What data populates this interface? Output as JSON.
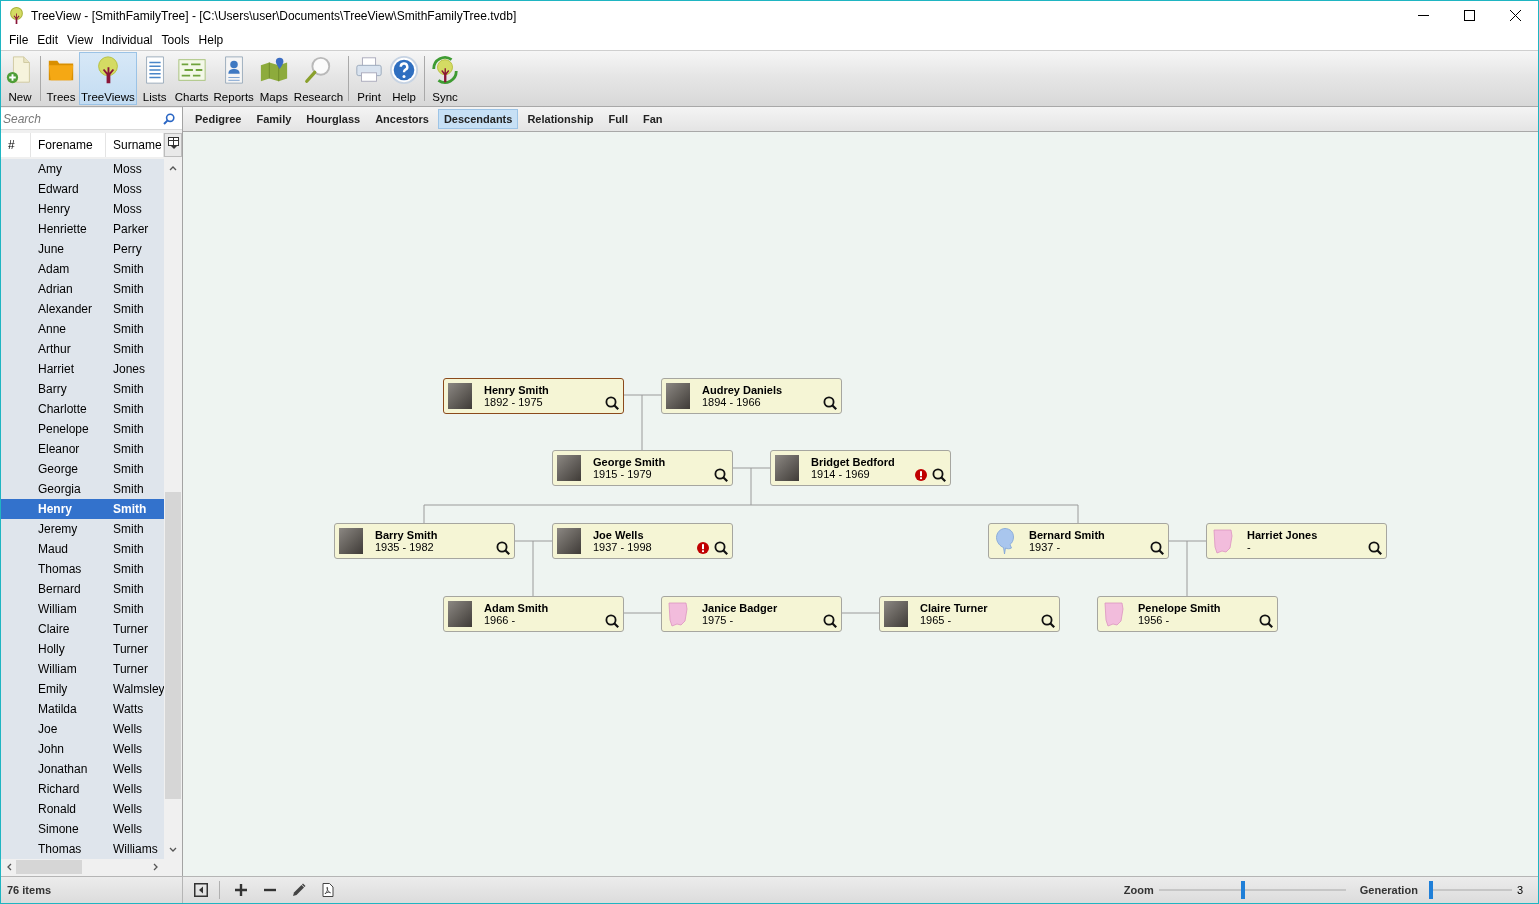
{
  "window": {
    "title": "TreeView - [SmithFamilyTree] - [C:\\Users\\user\\Documents\\TreeView\\SmithFamilyTree.tvdb]"
  },
  "menu": [
    "File",
    "Edit",
    "View",
    "Individual",
    "Tools",
    "Help"
  ],
  "toolbar": [
    {
      "buttons": [
        {
          "label": "New",
          "selected": false
        }
      ]
    },
    {
      "buttons": [
        {
          "label": "Trees",
          "selected": false
        },
        {
          "label": "TreeViews",
          "selected": true
        },
        {
          "label": "Lists",
          "selected": false
        },
        {
          "label": "Charts",
          "selected": false
        },
        {
          "label": "Reports",
          "selected": false
        },
        {
          "label": "Maps",
          "selected": false
        },
        {
          "label": "Research",
          "selected": false
        }
      ]
    },
    {
      "buttons": [
        {
          "label": "Print",
          "selected": false
        },
        {
          "label": "Help",
          "selected": false
        }
      ]
    },
    {
      "buttons": [
        {
          "label": "Sync",
          "selected": false
        }
      ]
    }
  ],
  "sidebar": {
    "search": {
      "placeholder": "Search"
    },
    "columns": [
      "#",
      "Forename",
      "Surname"
    ],
    "rows": [
      {
        "forename": "Amy",
        "surname": "Moss",
        "selected": false
      },
      {
        "forename": "Edward",
        "surname": "Moss",
        "selected": false
      },
      {
        "forename": "Henry",
        "surname": "Moss",
        "selected": false
      },
      {
        "forename": "Henriette",
        "surname": "Parker",
        "selected": false
      },
      {
        "forename": "June",
        "surname": "Perry",
        "selected": false
      },
      {
        "forename": "Adam",
        "surname": "Smith",
        "selected": false
      },
      {
        "forename": "Adrian",
        "surname": "Smith",
        "selected": false
      },
      {
        "forename": "Alexander",
        "surname": "Smith",
        "selected": false
      },
      {
        "forename": "Anne",
        "surname": "Smith",
        "selected": false
      },
      {
        "forename": "Arthur",
        "surname": "Smith",
        "selected": false
      },
      {
        "forename": "Harriet",
        "surname": "Jones",
        "selected": false
      },
      {
        "forename": "Barry",
        "surname": "Smith",
        "selected": false
      },
      {
        "forename": "Charlotte",
        "surname": "Smith",
        "selected": false
      },
      {
        "forename": "Penelope",
        "surname": "Smith",
        "selected": false
      },
      {
        "forename": "Eleanor",
        "surname": "Smith",
        "selected": false
      },
      {
        "forename": "George",
        "surname": "Smith",
        "selected": false
      },
      {
        "forename": "Georgia",
        "surname": "Smith",
        "selected": false
      },
      {
        "forename": "Henry",
        "surname": "Smith",
        "selected": true
      },
      {
        "forename": "Jeremy",
        "surname": "Smith",
        "selected": false
      },
      {
        "forename": "Maud",
        "surname": "Smith",
        "selected": false
      },
      {
        "forename": "Thomas",
        "surname": "Smith",
        "selected": false
      },
      {
        "forename": "Bernard",
        "surname": "Smith",
        "selected": false
      },
      {
        "forename": "William",
        "surname": "Smith",
        "selected": false
      },
      {
        "forename": "Claire",
        "surname": "Turner",
        "selected": false
      },
      {
        "forename": "Holly",
        "surname": "Turner",
        "selected": false
      },
      {
        "forename": "William",
        "surname": "Turner",
        "selected": false
      },
      {
        "forename": "Emily",
        "surname": "Walmsley",
        "selected": false
      },
      {
        "forename": "Matilda",
        "surname": "Watts",
        "selected": false
      },
      {
        "forename": "Joe",
        "surname": "Wells",
        "selected": false
      },
      {
        "forename": "John",
        "surname": "Wells",
        "selected": false
      },
      {
        "forename": "Jonathan",
        "surname": "Wells",
        "selected": false
      },
      {
        "forename": "Richard",
        "surname": "Wells",
        "selected": false
      },
      {
        "forename": "Ronald",
        "surname": "Wells",
        "selected": false
      },
      {
        "forename": "Simone",
        "surname": "Wells",
        "selected": false
      },
      {
        "forename": "Thomas",
        "surname": "Williams",
        "selected": false
      }
    ]
  },
  "view_tabs": [
    {
      "label": "Pedigree",
      "selected": false
    },
    {
      "label": "Family",
      "selected": false
    },
    {
      "label": "Hourglass",
      "selected": false
    },
    {
      "label": "Ancestors",
      "selected": false
    },
    {
      "label": "Descendants",
      "selected": true
    },
    {
      "label": "Relationship",
      "selected": false
    },
    {
      "label": "Full",
      "selected": false
    },
    {
      "label": "Fan",
      "selected": false
    }
  ],
  "chart": {
    "people": [
      {
        "name": "Henry Smith",
        "dates": "1892 - 1975",
        "kind": "photo",
        "selected": true,
        "warning": false
      },
      {
        "name": "Audrey Daniels",
        "dates": "1894 - 1966",
        "kind": "photo",
        "selected": false,
        "warning": false
      },
      {
        "name": "George Smith",
        "dates": "1915 - 1979",
        "kind": "photo",
        "selected": false,
        "warning": false
      },
      {
        "name": "Bridget Bedford",
        "dates": "1914 - 1969",
        "kind": "photo",
        "selected": false,
        "warning": true
      },
      {
        "name": "Barry Smith",
        "dates": "1935 - 1982",
        "kind": "photo",
        "selected": false,
        "warning": false
      },
      {
        "name": "Joe Wells",
        "dates": "1937 - 1998",
        "kind": "photo",
        "selected": false,
        "warning": true
      },
      {
        "name": "Bernard Smith",
        "dates": "1937 -",
        "kind": "male",
        "selected": false,
        "warning": false
      },
      {
        "name": "Harriet Jones",
        "dates": "-",
        "kind": "female",
        "selected": false,
        "warning": false
      },
      {
        "name": "Adam Smith",
        "dates": "1966 -",
        "kind": "photo",
        "selected": false,
        "warning": false
      },
      {
        "name": "Janice Badger",
        "dates": "1975 -",
        "kind": "female",
        "selected": false,
        "warning": false
      },
      {
        "name": "Claire Turner",
        "dates": "1965 -",
        "kind": "photo",
        "selected": false,
        "warning": false
      },
      {
        "name": "Penelope Smith",
        "dates": "1956 -",
        "kind": "female",
        "selected": false,
        "warning": false
      }
    ]
  },
  "status_bar": {
    "item_count": "76 items",
    "zoom": {
      "label": "Zoom",
      "level": 0.45
    },
    "generation": {
      "label": "Generation",
      "level": 0.03,
      "value": "3"
    }
  }
}
